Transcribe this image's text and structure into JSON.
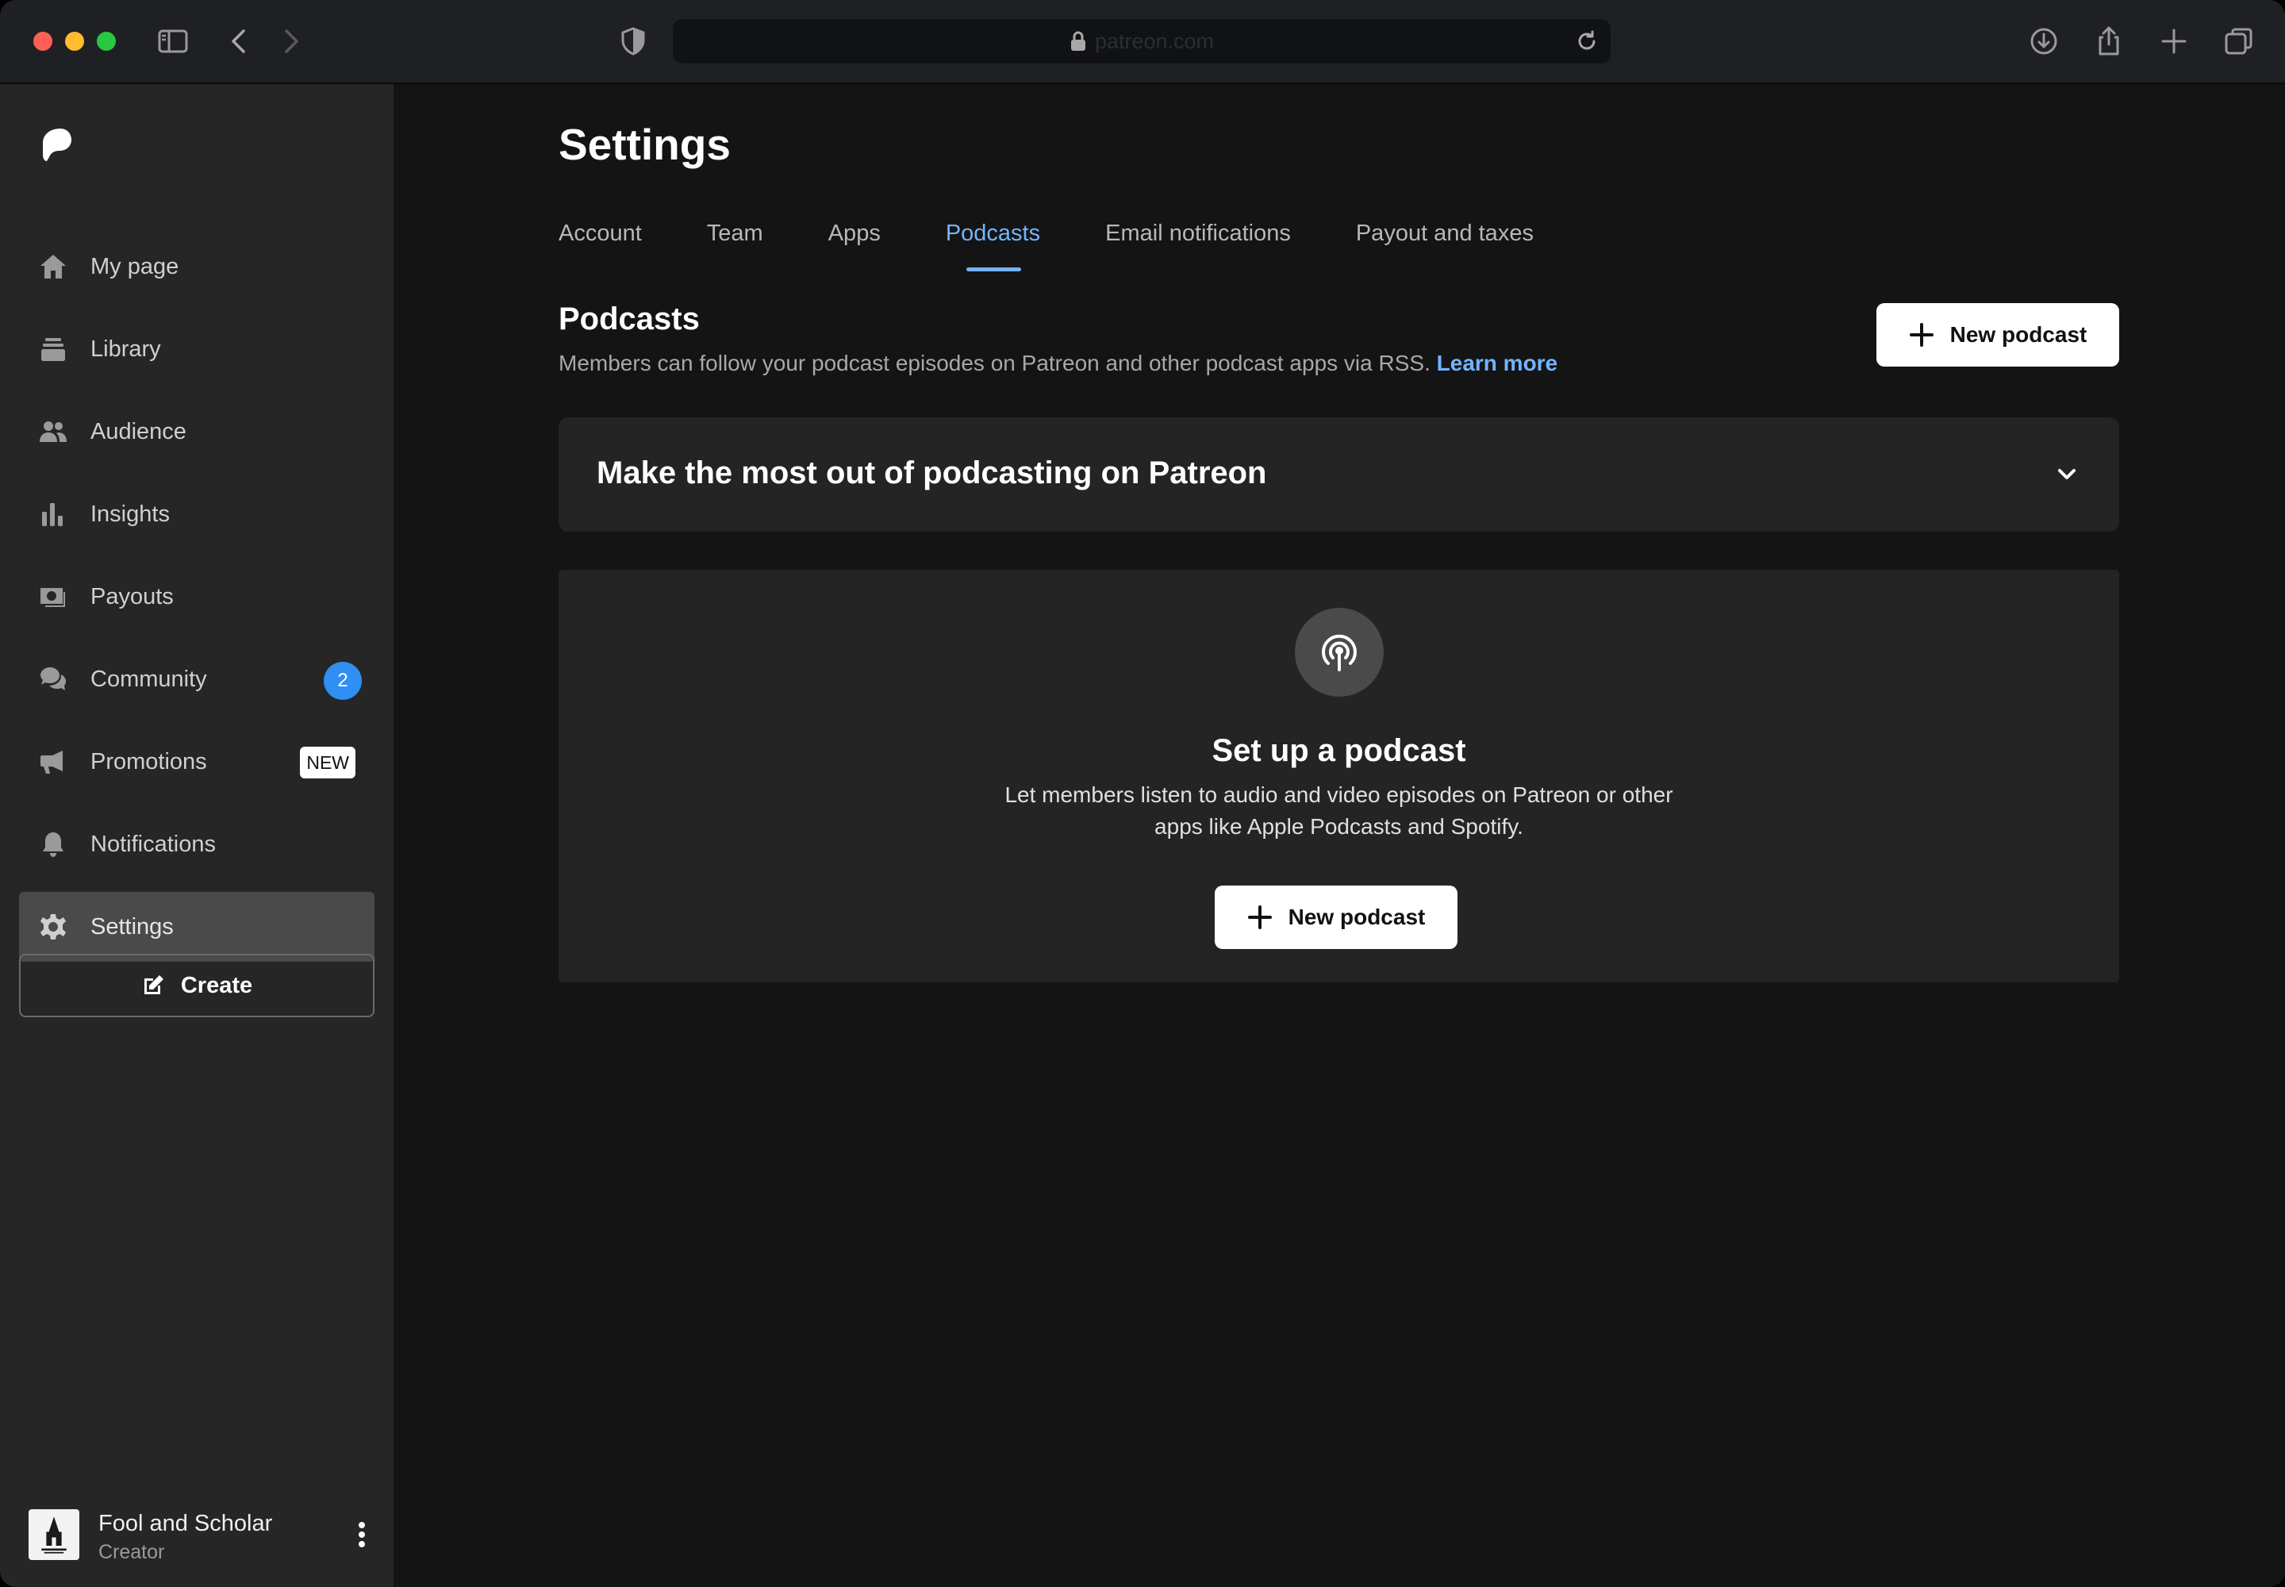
{
  "browser": {
    "url": "patreon.com"
  },
  "sidebar": {
    "items": [
      {
        "label": "My page",
        "icon": "home-icon"
      },
      {
        "label": "Library",
        "icon": "library-icon"
      },
      {
        "label": "Audience",
        "icon": "people-icon"
      },
      {
        "label": "Insights",
        "icon": "bar-chart-icon"
      },
      {
        "label": "Payouts",
        "icon": "money-icon"
      },
      {
        "label": "Community",
        "icon": "chat-bubbles-icon",
        "badge": "2"
      },
      {
        "label": "Promotions",
        "icon": "megaphone-icon",
        "tag": "NEW"
      },
      {
        "label": "Notifications",
        "icon": "bell-icon"
      },
      {
        "label": "Settings",
        "icon": "gear-icon",
        "active": true
      }
    ],
    "create_label": "Create",
    "profile": {
      "name": "Fool and Scholar",
      "role": "Creator"
    }
  },
  "main": {
    "title": "Settings",
    "tabs": [
      {
        "label": "Account"
      },
      {
        "label": "Team"
      },
      {
        "label": "Apps"
      },
      {
        "label": "Podcasts",
        "active": true
      },
      {
        "label": "Email notifications"
      },
      {
        "label": "Payout and taxes"
      }
    ],
    "section": {
      "title": "Podcasts",
      "description": "Members can follow your podcast episodes on Patreon and other podcast apps via RSS.",
      "learn_more": "Learn more",
      "new_button": "New podcast"
    },
    "accordion": {
      "title": "Make the most out of podcasting on Patreon"
    },
    "empty_state": {
      "title": "Set up a podcast",
      "description_line1": "Let members listen to audio and video episodes on Patreon or other",
      "description_line2": "apps like Apple Podcasts and Spotify.",
      "button": "New podcast"
    }
  },
  "colors": {
    "accent": "#72b4ff",
    "badge": "#2f8ff3",
    "sidebar_bg": "#262626",
    "main_bg": "#141414",
    "card_bg": "#242424"
  }
}
